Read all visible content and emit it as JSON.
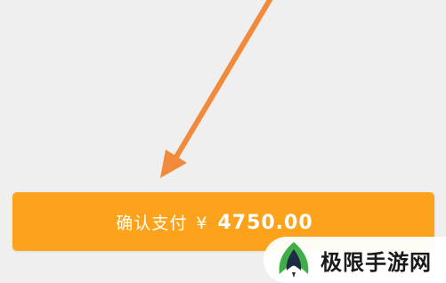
{
  "payment": {
    "confirm_label": "确认支付",
    "currency_symbol": "¥",
    "amount": "4750.00"
  },
  "watermark": {
    "site_name": "极限手游网"
  },
  "colors": {
    "background": "#efefef",
    "button": "#fda31b",
    "button_text": "#ffffff",
    "arrow": "#f28a3c",
    "logo_green": "#3fae48",
    "logo_dark": "#1f2a44"
  },
  "icons": {
    "pointer": "arrow-annotation-icon",
    "logo": "site-logo-icon"
  }
}
